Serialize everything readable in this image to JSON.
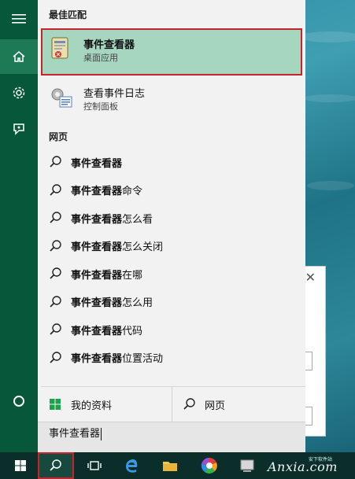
{
  "rail": {
    "menu_icon": "hamburger-icon",
    "home_icon": "home-icon",
    "settings_icon": "gear-icon",
    "feedback_icon": "feedback-icon",
    "cortana_icon": "cortana-circle-icon"
  },
  "best_match": {
    "header": "最佳匹配",
    "title": "事件查看器",
    "subtitle": "桌面应用"
  },
  "second_result": {
    "title": "查看事件日志",
    "subtitle": "控制面板"
  },
  "web": {
    "header": "网页",
    "items": [
      {
        "bold": "事件查看器",
        "rest": ""
      },
      {
        "bold": "事件查看器",
        "rest": "命令"
      },
      {
        "bold": "事件查看器",
        "rest": "怎么看"
      },
      {
        "bold": "事件查看器",
        "rest": "怎么关闭"
      },
      {
        "bold": "事件查看器",
        "rest": "在哪"
      },
      {
        "bold": "事件查看器",
        "rest": "怎么用"
      },
      {
        "bold": "事件查看器",
        "rest": "代码"
      },
      {
        "bold": "事件查看器",
        "rest": " 位置活动"
      }
    ]
  },
  "bottom": {
    "my_stuff": "我的资料",
    "web": "网页"
  },
  "search": {
    "value": "事件查看器"
  },
  "taskbar": {
    "watermark": "Anxia.com",
    "watermark_sub": "安下软件站"
  },
  "colors": {
    "rail": "#07583a",
    "highlight": "#a6d6c0",
    "annotation_red": "#c8222a",
    "taskbar": "#0b2e2a"
  }
}
